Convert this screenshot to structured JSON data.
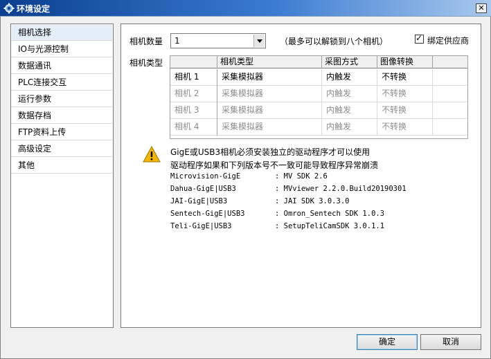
{
  "window": {
    "title": "环境设定",
    "close_label": "✕"
  },
  "sidebar": {
    "items": [
      {
        "label": "相机选择",
        "active": true
      },
      {
        "label": "IO与光源控制",
        "active": false
      },
      {
        "label": "数据通讯",
        "active": false
      },
      {
        "label": "PLC连接交互",
        "active": false
      },
      {
        "label": "运行参数",
        "active": false
      },
      {
        "label": "数据存档",
        "active": false
      },
      {
        "label": "FTP资料上传",
        "active": false
      },
      {
        "label": "高级设定",
        "active": false
      },
      {
        "label": "其他",
        "active": false
      }
    ]
  },
  "camera_count": {
    "label": "相机数量",
    "value": "1",
    "hint": "（最多可以解锁到八个相机）"
  },
  "bind_vendor": {
    "label": "绑定供应商",
    "checked": true
  },
  "camera_type": {
    "label": "相机类型",
    "columns": [
      "相机类型",
      "采图方式",
      "图像转换"
    ],
    "rows": [
      {
        "name": "相机 1",
        "type": "采集模拟器",
        "mode": "内触发",
        "convert": "不转换",
        "enabled": true
      },
      {
        "name": "相机 2",
        "type": "采集模拟器",
        "mode": "内触发",
        "convert": "不转换",
        "enabled": false
      },
      {
        "name": "相机 3",
        "type": "采集模拟器",
        "mode": "内触发",
        "convert": "不转换",
        "enabled": false
      },
      {
        "name": "相机 4",
        "type": "采集模拟器",
        "mode": "内触发",
        "convert": "不转换",
        "enabled": false
      }
    ]
  },
  "notice": {
    "line1": "GigE或USB3相机必须安装独立的驱动程序才可以使用",
    "line2": "驱动程序如果和下列版本号不一致可能导致程序异常崩溃",
    "drivers": [
      {
        "name": "Microvision-GigE",
        "version": ": MV SDK 2.6"
      },
      {
        "name": "Dahua-GigE|USB3",
        "version": ": MVviewer 2.2.0.Build20190301"
      },
      {
        "name": "JAI-GigE|USB3",
        "version": ": JAI SDK 3.0.3.0"
      },
      {
        "name": "Sentech-GigE|USB3",
        "version": ": Omron_Sentech SDK 1.0.3"
      },
      {
        "name": "Teli-GigE|USB3",
        "version": ": SetupTeliCamSDK 3.0.1.1"
      }
    ]
  },
  "buttons": {
    "ok": "确定",
    "cancel": "取消"
  },
  "colors": {
    "title_bar": "#0b3f8f",
    "warning": "#f2b705",
    "selected_nav": "#e3eef9"
  }
}
